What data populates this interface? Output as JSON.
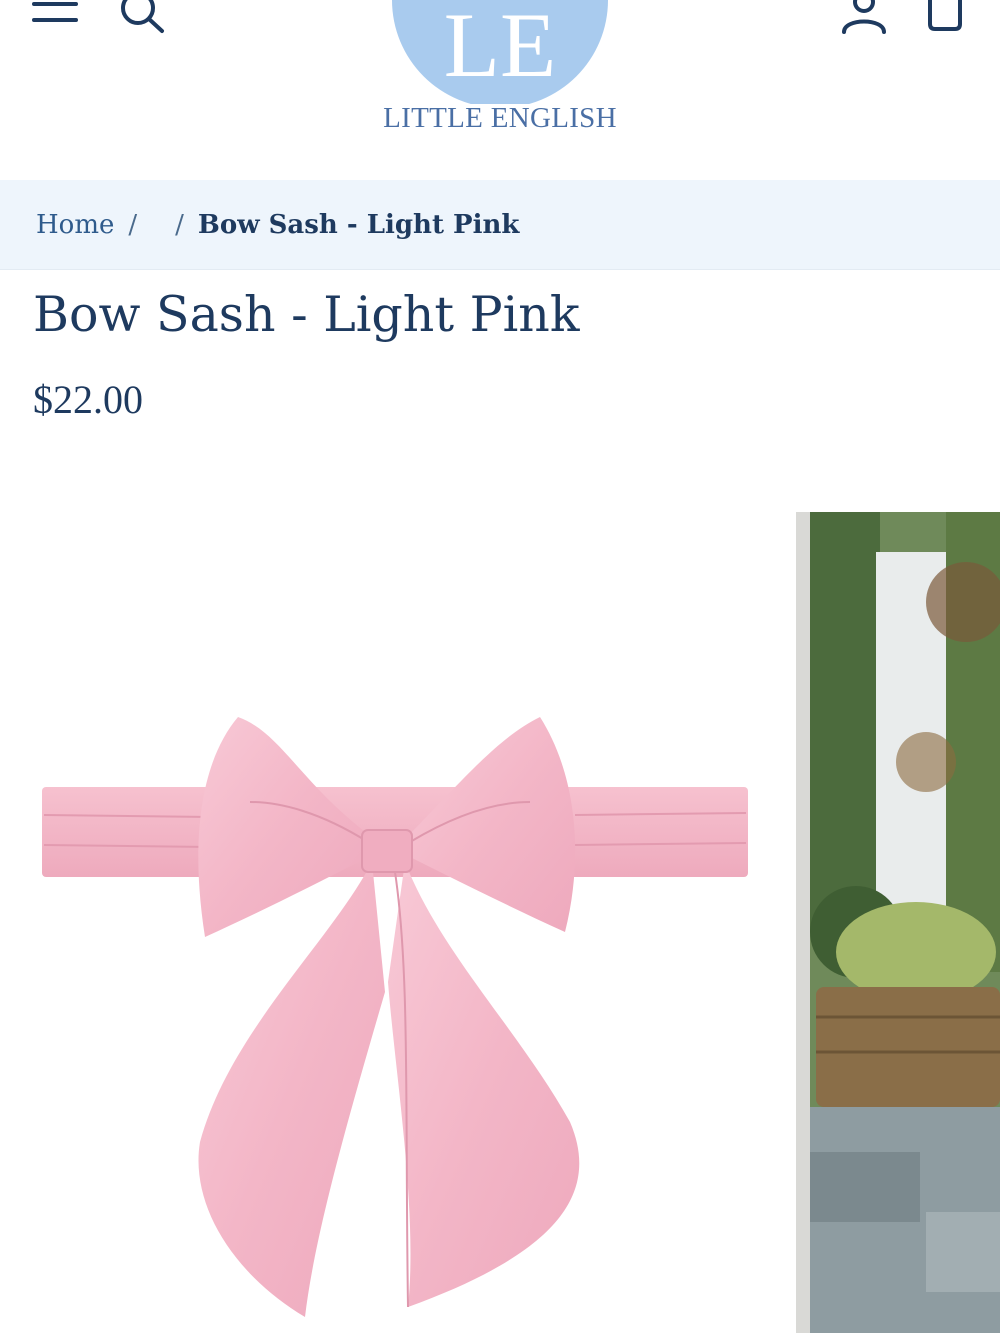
{
  "header": {
    "icons": [
      "menu-icon",
      "search-icon",
      "account-icon",
      "cart-icon"
    ],
    "logo_monogram": "LE",
    "logo_text": "LITTLE ENGLISH",
    "brand_colors": {
      "logo_circle": "#a9cbee",
      "navy": "#1e3a5f",
      "breadcrumb_bg": "#eef5fc"
    }
  },
  "breadcrumb": {
    "home": "Home",
    "separator": "/",
    "current": "Bow Sash - Light Pink"
  },
  "product": {
    "title": "Bow Sash - Light Pink",
    "price": "$22.00",
    "accent_color": "#f3b8c8"
  },
  "gallery": {
    "main_image": "pink-bow-sash-product-photo",
    "next_image": "porch-lifestyle-photo"
  }
}
